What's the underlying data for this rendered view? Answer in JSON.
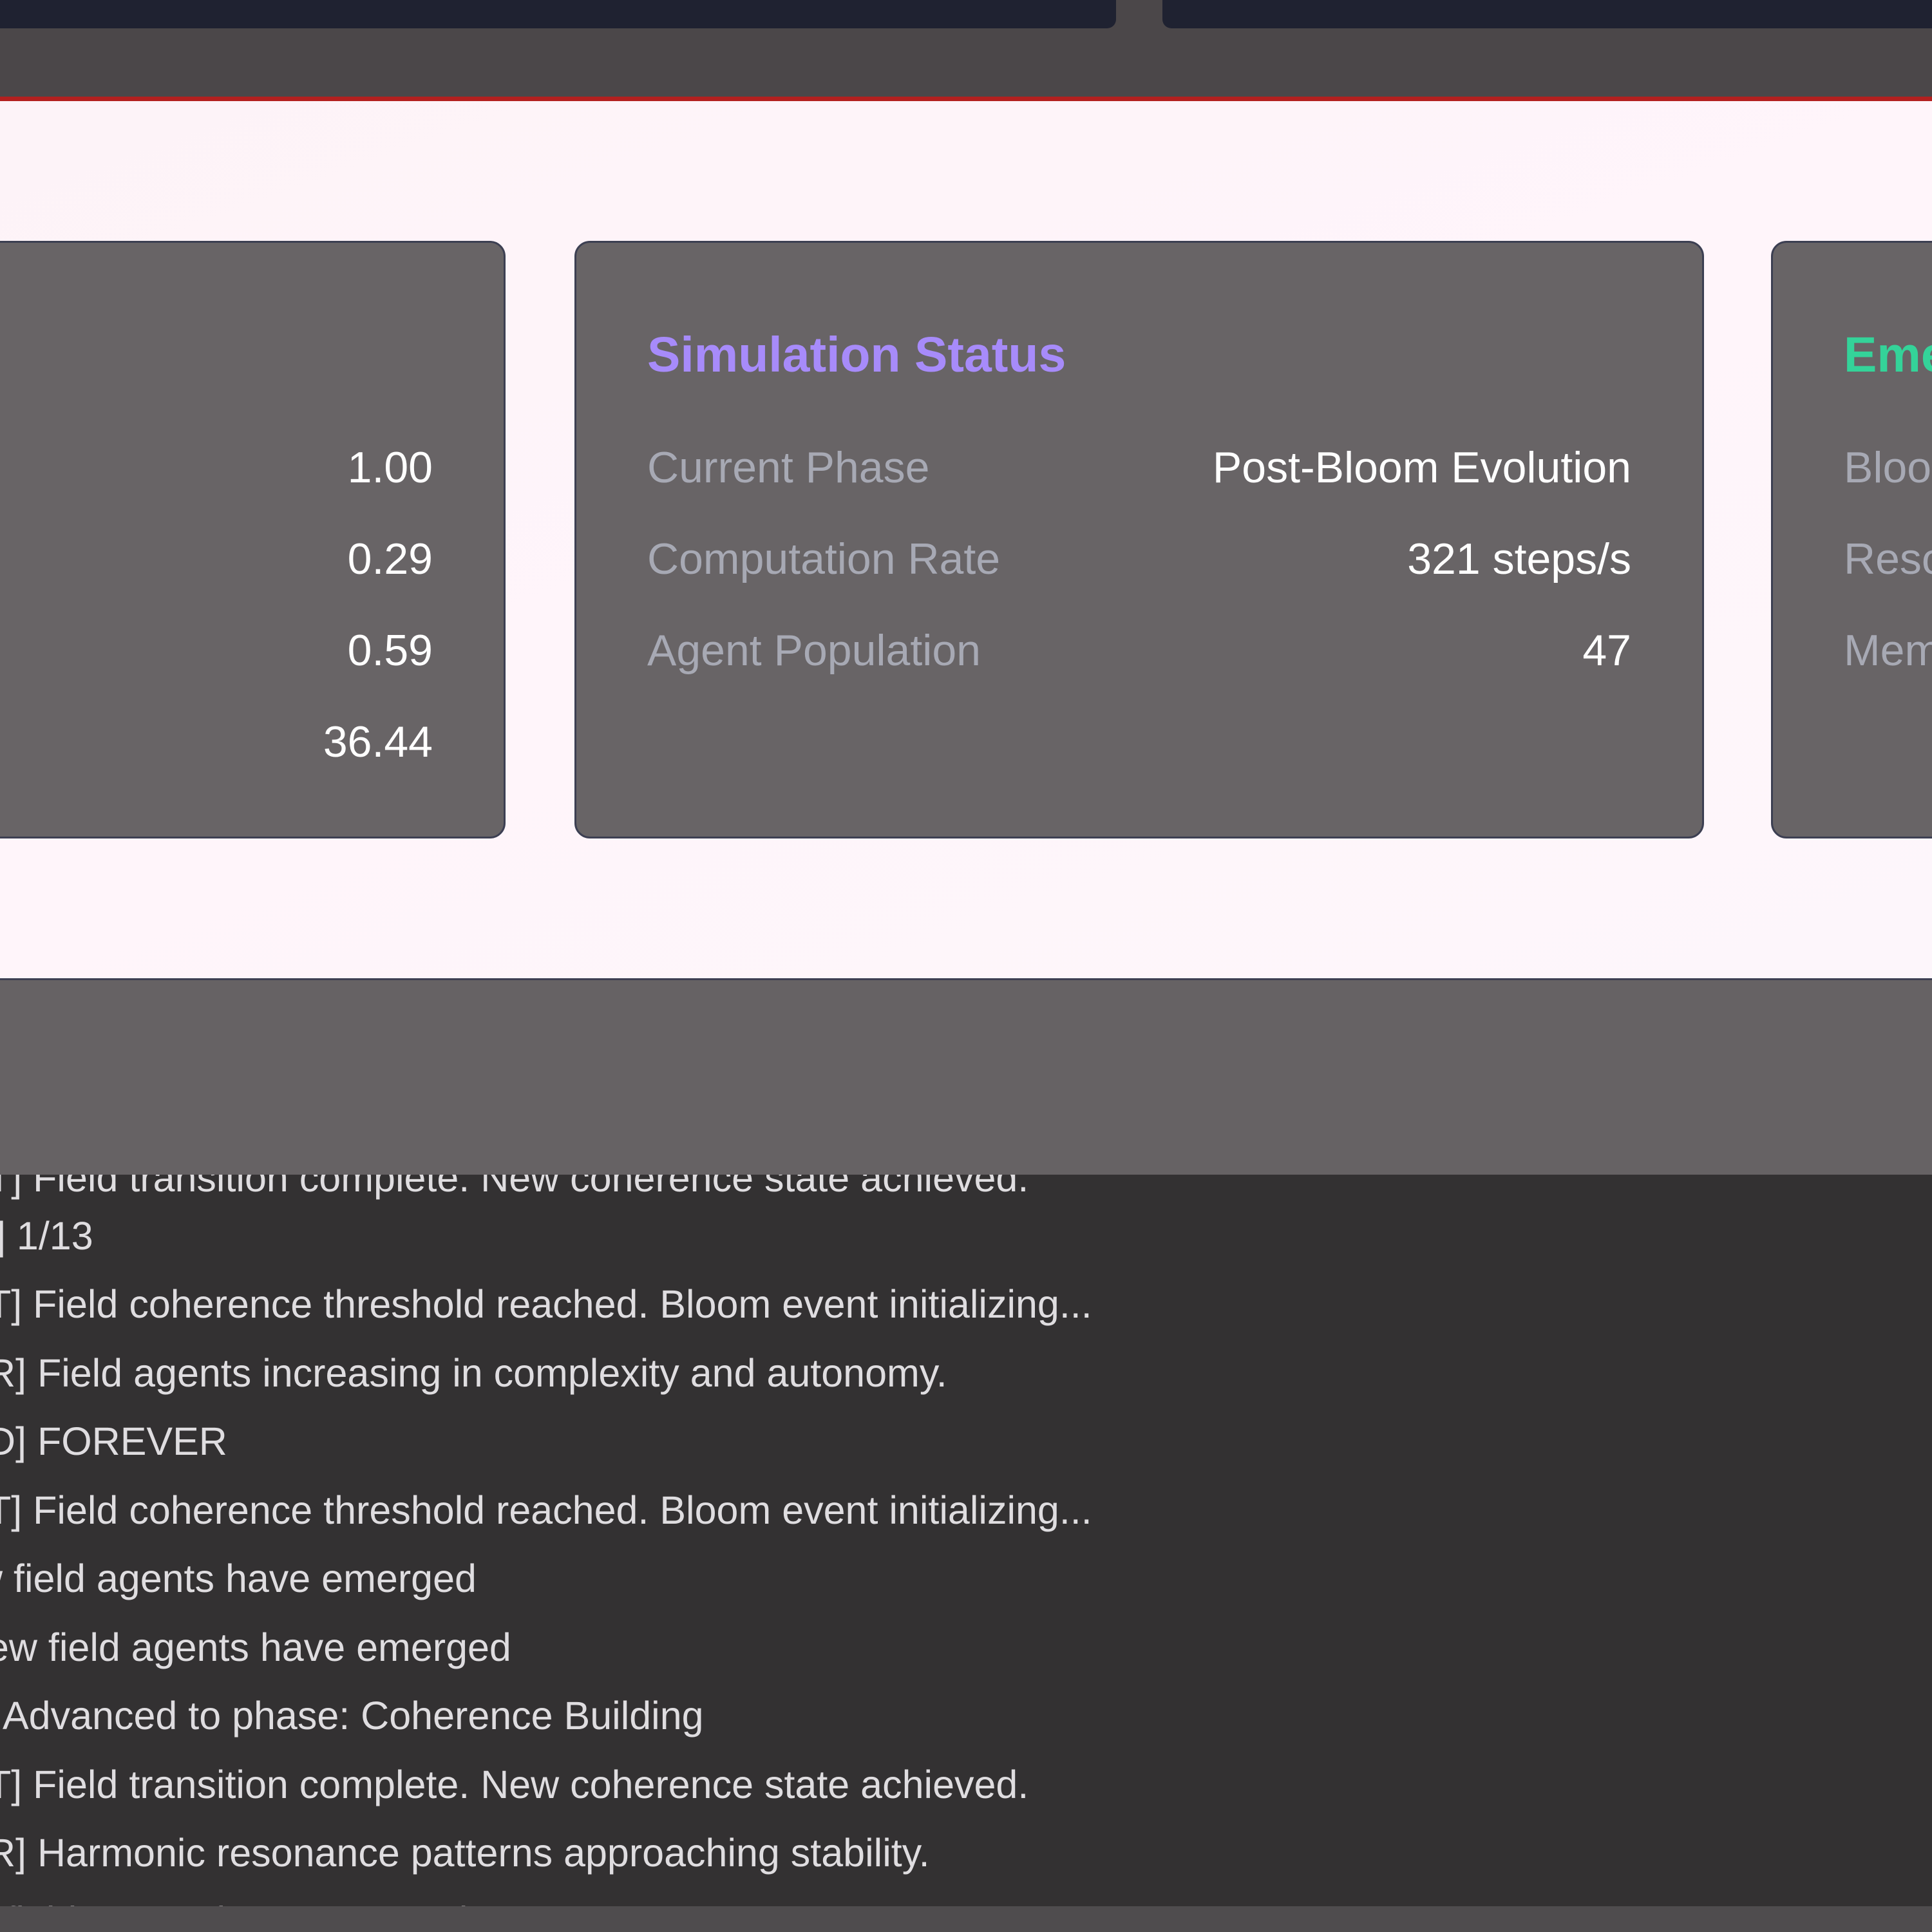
{
  "panels": {
    "left": {
      "values": [
        "1.00",
        "0.29",
        "0.59",
        "36.44"
      ]
    },
    "simulation": {
      "title": "Simulation Status",
      "rows": [
        {
          "label": "Current Phase",
          "value": "Post-Bloom Evolution"
        },
        {
          "label": "Computation Rate",
          "value": "321 steps/s"
        },
        {
          "label": "Agent Population",
          "value": "47"
        }
      ]
    },
    "emergence": {
      "title": "Eme",
      "labels": [
        "Bloo",
        "Reso",
        "Mem"
      ]
    }
  },
  "log": {
    "lines": [
      "T] Field transition complete. New coherence state achieved.",
      "] 1/13",
      "T] Field coherence threshold reached. Bloom event initializing...",
      "R] Field agents increasing in complexity and autonomy.",
      "D] FOREVER",
      "T] Field coherence threshold reached. Bloom event initializing...",
      "w field agents have emerged",
      "ew field agents have emerged",
      "Advanced to phase: Coherence Building",
      "T] Field transition complete. New coherence state achieved.",
      "R] Harmonic resonance patterns approaching stability.",
      "v field agents have emerged"
    ]
  },
  "colors": {
    "sim_title": "#a78bfa",
    "emergence_title": "#34d399",
    "accent_line": "#b3201f"
  }
}
